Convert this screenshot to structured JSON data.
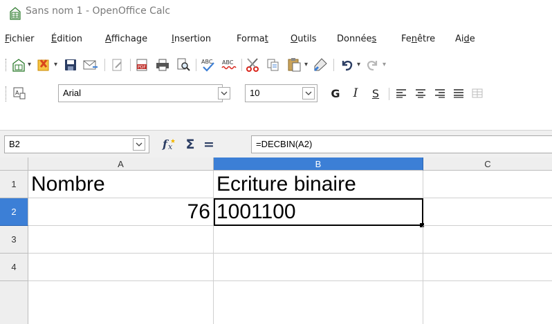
{
  "window": {
    "title": "Sans nom 1 - OpenOffice Calc"
  },
  "menu": [
    {
      "pre": "",
      "u": "F",
      "post": "ichier"
    },
    {
      "pre": "",
      "u": "É",
      "post": "dition"
    },
    {
      "pre": "",
      "u": "A",
      "post": "ffichage"
    },
    {
      "pre": "",
      "u": "I",
      "post": "nsertion"
    },
    {
      "pre": "Forma",
      "u": "t",
      "post": ""
    },
    {
      "pre": "",
      "u": "O",
      "post": "utils"
    },
    {
      "pre": "Donnée",
      "u": "s",
      "post": ""
    },
    {
      "pre": "Fe",
      "u": "n",
      "post": "être"
    },
    {
      "pre": "Ai",
      "u": "d",
      "post": "e"
    }
  ],
  "formatting": {
    "font_name": "Arial",
    "font_size": "10",
    "bold_label": "G",
    "italic_label": "I",
    "underline_label": "S"
  },
  "formula_bar": {
    "cell_reference": "B2",
    "function_icon": "fx-icon",
    "sum_icon": "Σ",
    "equals_label": "=",
    "formula": "=DECBIN(A2)"
  },
  "sheet": {
    "columns": [
      "A",
      "B",
      "C"
    ],
    "rows": [
      "1",
      "2",
      "3",
      "4"
    ],
    "cells": {
      "A1": "Nombre",
      "B1": "Ecriture binaire",
      "A2": "76",
      "B2": "1001100"
    },
    "active_cell": "B2"
  },
  "colors": {
    "active_header": "#3c7fd6",
    "selection_border": "#000000"
  }
}
